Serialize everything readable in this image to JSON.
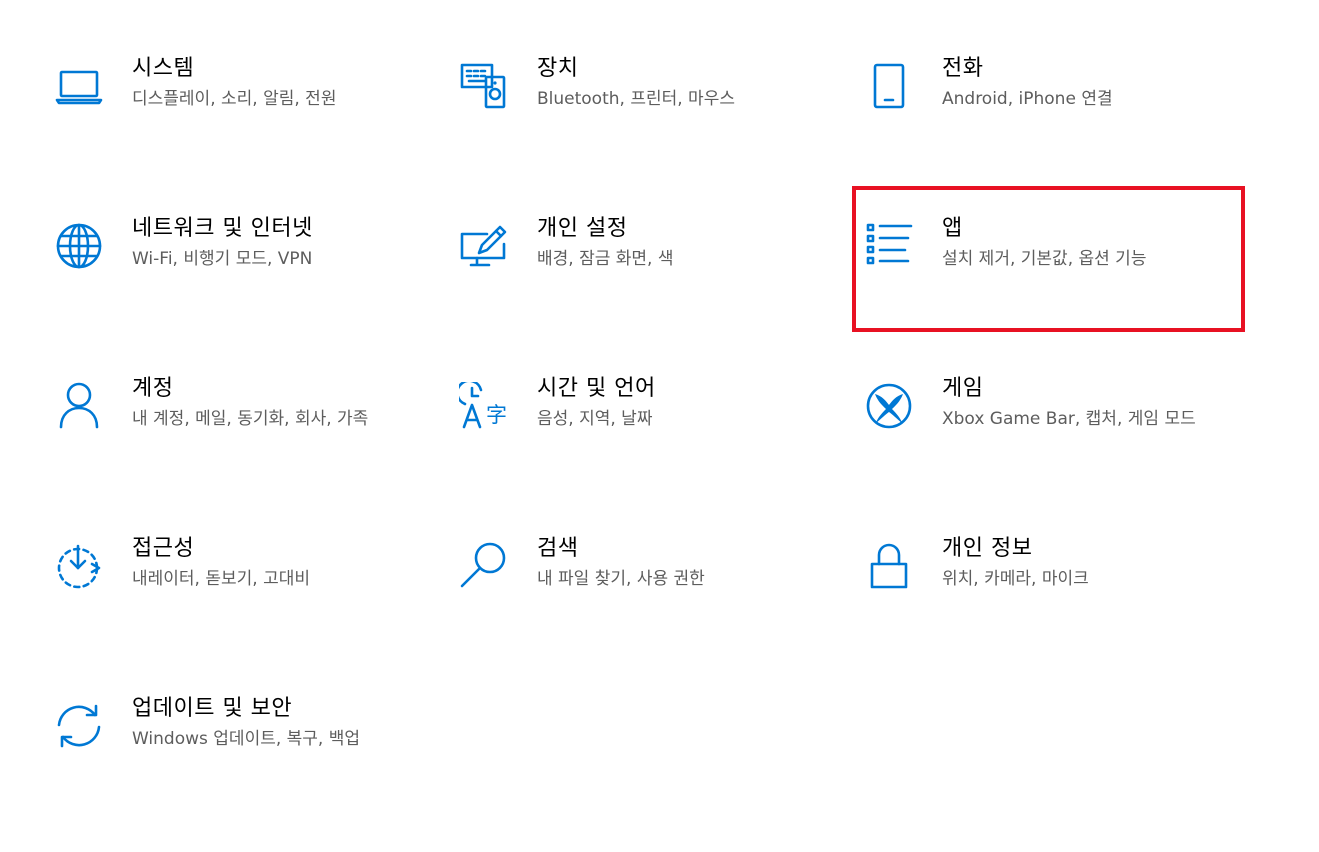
{
  "accent_color": "#0078d4",
  "highlight_color": "#e81123",
  "tiles": [
    {
      "id": "system",
      "title": "시스템",
      "desc": "디스플레이, 소리, 알림, 전원",
      "icon": "laptop-icon"
    },
    {
      "id": "devices",
      "title": "장치",
      "desc": "Bluetooth, 프린터, 마우스",
      "icon": "devices-icon"
    },
    {
      "id": "phone",
      "title": "전화",
      "desc": "Android, iPhone 연결",
      "icon": "phone-icon"
    },
    {
      "id": "network",
      "title": "네트워크 및 인터넷",
      "desc": "Wi-Fi, 비행기 모드, VPN",
      "icon": "globe-icon"
    },
    {
      "id": "personalization",
      "title": "개인 설정",
      "desc": "배경, 잠금 화면, 색",
      "icon": "personalization-icon"
    },
    {
      "id": "apps",
      "title": "앱",
      "desc": "설치 제거, 기본값, 옵션 기능",
      "icon": "apps-list-icon"
    },
    {
      "id": "accounts",
      "title": "계정",
      "desc": "내 계정, 메일, 동기화, 회사, 가족",
      "icon": "person-icon"
    },
    {
      "id": "time_language",
      "title": "시간 및 언어",
      "desc": "음성, 지역, 날짜",
      "icon": "time-language-icon"
    },
    {
      "id": "gaming",
      "title": "게임",
      "desc": "Xbox Game Bar, 캡처, 게임 모드",
      "icon": "xbox-icon"
    },
    {
      "id": "ease_of_access",
      "title": "접근성",
      "desc": "내레이터, 돋보기, 고대비",
      "icon": "ease-of-access-icon"
    },
    {
      "id": "search",
      "title": "검색",
      "desc": "내 파일 찾기, 사용 권한",
      "icon": "search-icon"
    },
    {
      "id": "privacy",
      "title": "개인 정보",
      "desc": "위치, 카메라, 마이크",
      "icon": "lock-icon"
    },
    {
      "id": "update_security",
      "title": "업데이트 및 보안",
      "desc": "Windows 업데이트, 복구, 백업",
      "icon": "sync-icon"
    }
  ]
}
